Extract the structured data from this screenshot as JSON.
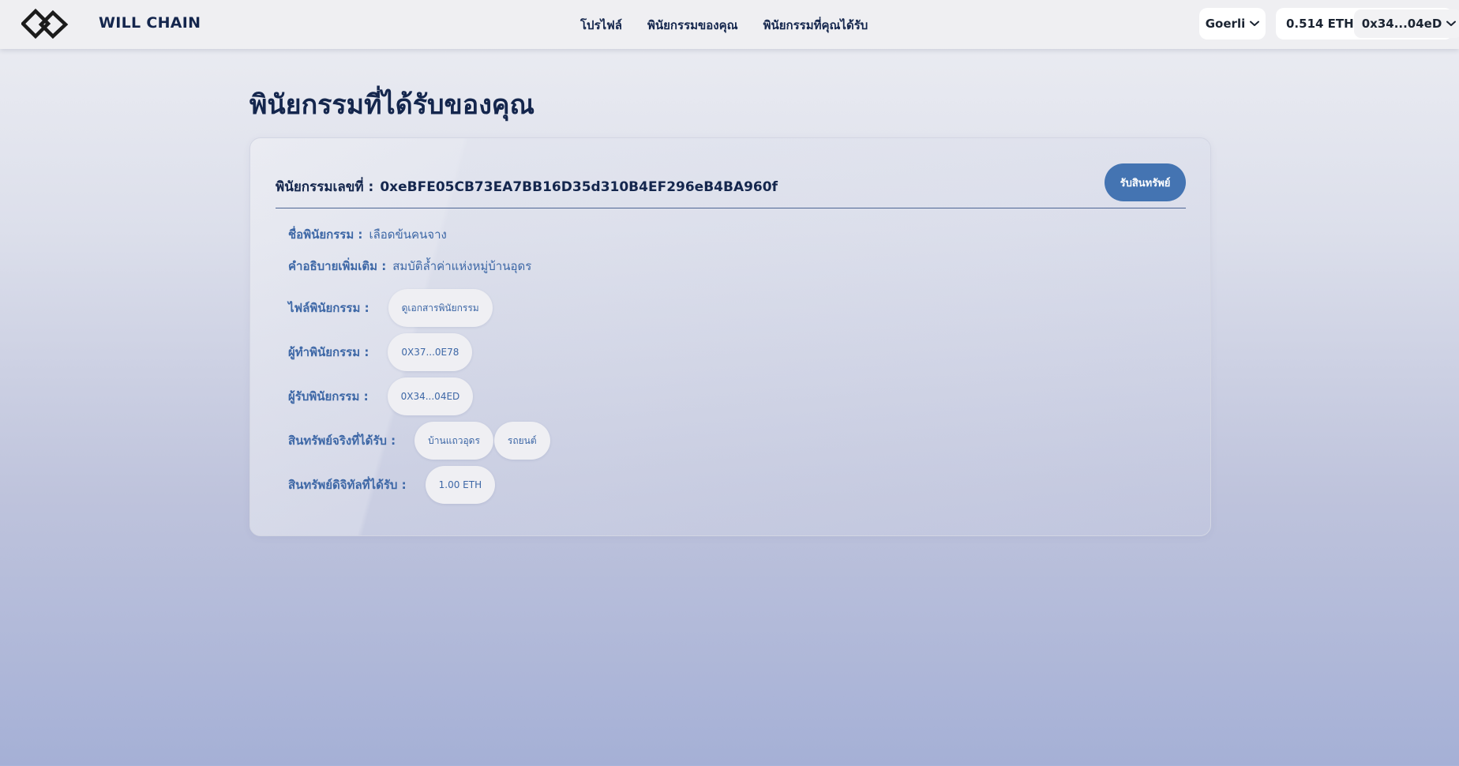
{
  "header": {
    "brand": "WILL CHAIN",
    "nav": {
      "profile": "โปรไฟล์",
      "my_wills": "พินัยกรรมของคุณ",
      "received_wills": "พินัยกรรมที่คุณได้รับ"
    },
    "network": "Goerli",
    "balance": "0.514 ETH",
    "account": "0x34...04eD"
  },
  "main": {
    "title": "พินัยกรรมที่ได้รับของคุณ",
    "will": {
      "number_label": "พินัยกรรมเลขที่ :",
      "number_value": "0xeBFE05CB73EA7BB16D35d310B4EF296eB4BA960f",
      "claim_button": "รับสินทรัพย์",
      "name_label": "ชื่อพินัยกรรม :",
      "name_value": "เลือดข้นคนจาง",
      "description_label": "คำอธิบายเพิ่มเติม :",
      "description_value": "สมบัติล้ำค่าแห่งหมู่บ้านอุดร",
      "file_label": "ไฟล์พินัยกรรม :",
      "file_button": "ดูเอกสารพินัยกรรม",
      "testator_label": "ผู้ทำพินัยกรรม :",
      "testator_value": "0X37...0E78",
      "beneficiary_label": "ผู้รับพินัยกรรม :",
      "beneficiary_value": "0X34...04ED",
      "real_assets_label": "สินทรัพย์จริงที่ได้รับ :",
      "real_assets": [
        "บ้านแถวอุดร",
        "รถยนต์"
      ],
      "digital_assets_label": "สินทรัพย์ดิจิทัลที่ได้รับ :",
      "digital_assets": [
        "1.00 ETH"
      ]
    }
  },
  "icons": {
    "logo": "will-chain-logo",
    "network_chevron": "chevron-down-icon",
    "account_chevron": "chevron-down-icon"
  },
  "colors": {
    "navy": "#14264d",
    "accent": "#4474b2",
    "label_blue": "#3d67a6",
    "header_bg": "#efeff2"
  }
}
